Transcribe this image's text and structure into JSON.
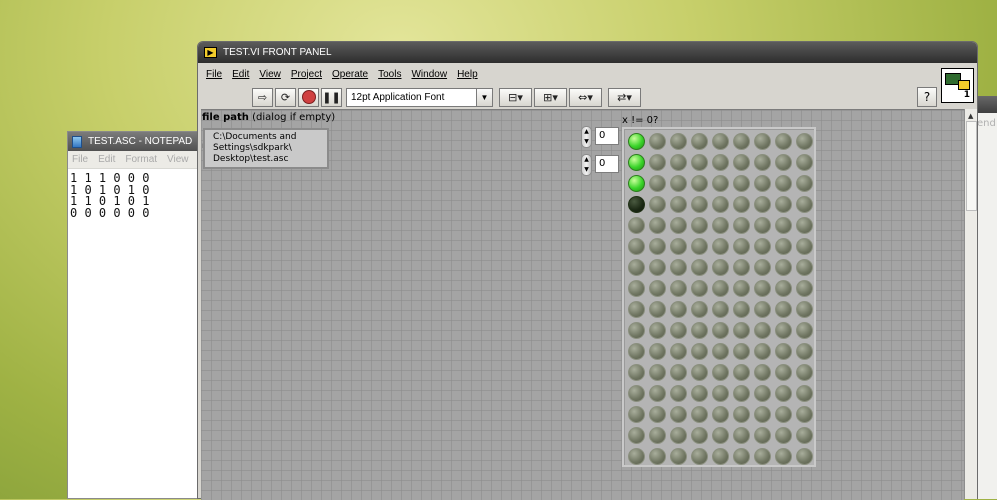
{
  "background_window": {
    "partial_text": "end"
  },
  "notepad": {
    "title": "TEST.ASC - NOTEPAD",
    "menu": [
      "File",
      "Edit",
      "Format",
      "View"
    ],
    "content": "1 1 1 0 0 0\n1 0 1 0 1 0\n1 1 0 1 0 1\n0 0 0 0 0 0"
  },
  "panel": {
    "title": "TEST.VI FRONT PANEL",
    "menu": [
      "File",
      "Edit",
      "View",
      "Project",
      "Operate",
      "Tools",
      "Window",
      "Help"
    ],
    "toolbar": {
      "run_icon": "run-arrow-icon",
      "run_continuous_icon": "run-continuously-icon",
      "abort_icon": "abort-icon",
      "pause_icon": "pause-icon",
      "font": "12pt Application Font",
      "align_icon": "align-objects-icon",
      "distribute_icon": "distribute-objects-icon",
      "resize_icon": "resize-objects-icon",
      "reorder_icon": "reorder-icon",
      "help_label": "?"
    },
    "vi_icon_number": "1",
    "file_path": {
      "label_bold": "file path",
      "label_rest": "(dialog if empty)",
      "value_lines": [
        "C:\\Documents and",
        "Settings\\sdkpark\\",
        "Desktop\\test.asc"
      ]
    },
    "index_row": "0",
    "index_col": "0",
    "array_label": "x != 0?",
    "leds": {
      "columns": 9,
      "rows": 16,
      "first_column_states": [
        "on",
        "on",
        "on",
        "dark"
      ]
    }
  }
}
